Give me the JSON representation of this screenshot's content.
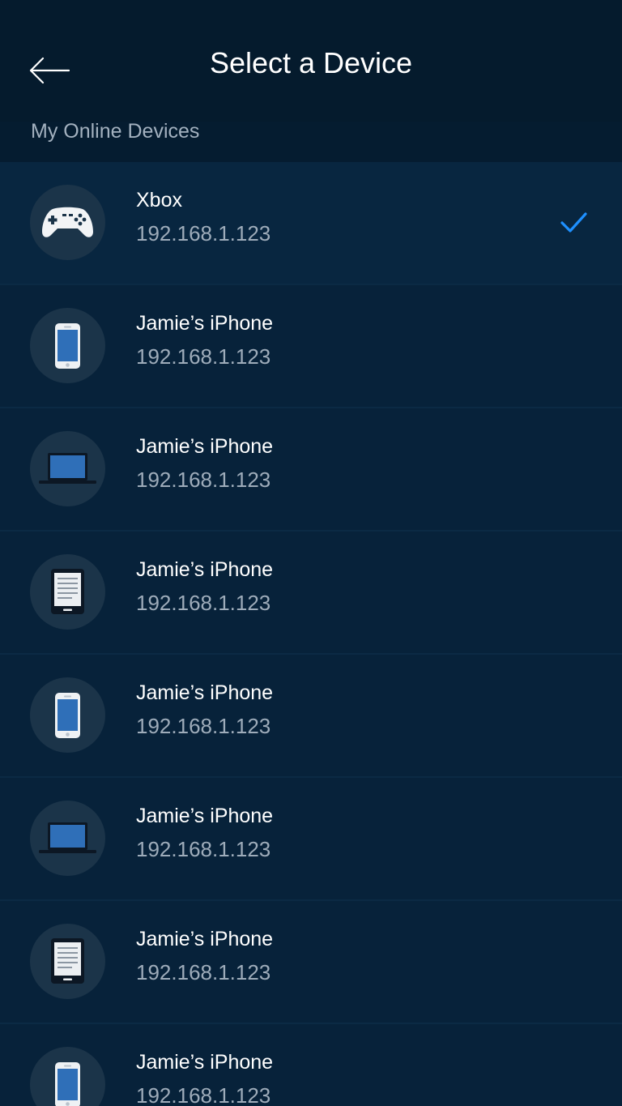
{
  "header": {
    "title": "Select a Device",
    "back_icon": "back-arrow-icon"
  },
  "section": {
    "label": "My Online Devices"
  },
  "colors": {
    "background": "#051c30",
    "row": "#07223a",
    "icon_circle": "#1b3449",
    "accent_check": "#1e90ff",
    "secondary_text": "#9eacba"
  },
  "devices": [
    {
      "name": "Xbox",
      "ip": "192.168.1.123",
      "icon": "gamepad-icon",
      "selected": true
    },
    {
      "name": "Jamie’s iPhone",
      "ip": "192.168.1.123",
      "icon": "phone-icon",
      "selected": false
    },
    {
      "name": "Jamie’s iPhone",
      "ip": "192.168.1.123",
      "icon": "laptop-icon",
      "selected": false
    },
    {
      "name": "Jamie’s iPhone",
      "ip": "192.168.1.123",
      "icon": "ereader-icon",
      "selected": false
    },
    {
      "name": "Jamie’s iPhone",
      "ip": "192.168.1.123",
      "icon": "phone-icon",
      "selected": false
    },
    {
      "name": "Jamie’s iPhone",
      "ip": "192.168.1.123",
      "icon": "laptop-icon",
      "selected": false
    },
    {
      "name": "Jamie’s iPhone",
      "ip": "192.168.1.123",
      "icon": "ereader-icon",
      "selected": false
    },
    {
      "name": "Jamie’s iPhone",
      "ip": "192.168.1.123",
      "icon": "phone-icon",
      "selected": false
    }
  ]
}
